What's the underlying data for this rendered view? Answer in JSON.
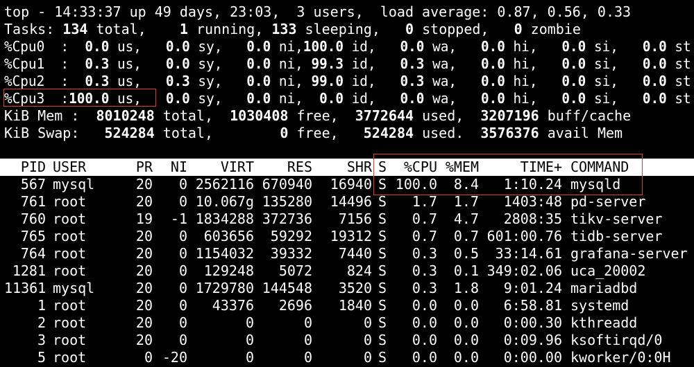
{
  "summary": {
    "top_line": "top - 14:33:37 up 49 days, 23:03,  3 users,  load average: 0.87, 0.56, 0.33",
    "tasks": {
      "label": "Tasks:",
      "total": "134",
      "total_lbl": " total,",
      "running": "1",
      "running_lbl": " running,",
      "sleeping": "133",
      "sleeping_lbl": " sleeping,",
      "stopped": "0",
      "stopped_lbl": " stopped,",
      "zombie": "0",
      "zombie_lbl": " zombie"
    },
    "cpus": [
      {
        "label": "%Cpu0  :",
        "us": "  0.0",
        "sy": "  0.0",
        "ni": "  0.0",
        "id": "100.0",
        "wa": "  0.0",
        "hi": "  0.0",
        "si": "  0.0",
        "st": "  0.0"
      },
      {
        "label": "%Cpu1  :",
        "us": "  0.3",
        "sy": "  0.0",
        "ni": "  0.0",
        "id": " 99.3",
        "wa": "  0.3",
        "hi": "  0.0",
        "si": "  0.0",
        "st": "  0.0"
      },
      {
        "label": "%Cpu2  :",
        "us": "  0.3",
        "sy": "  0.3",
        "ni": "  0.0",
        "id": " 99.0",
        "wa": "  0.3",
        "hi": "  0.0",
        "si": "  0.0",
        "st": "  0.0"
      },
      {
        "label": "%Cpu3  :",
        "us": "100.0",
        "sy": "  0.0",
        "ni": "  0.0",
        "id": "  0.0",
        "wa": "  0.0",
        "hi": "  0.0",
        "si": "  0.0",
        "st": "  0.0"
      }
    ],
    "mem": {
      "label": "KiB Mem : ",
      "total": " 8010248",
      "total_lbl": " total, ",
      "free": " 1030408",
      "free_lbl": " free, ",
      "used": " 3772644",
      "used_lbl": " used, ",
      "cache": " 3207196",
      "cache_lbl": " buff/cache"
    },
    "swap": {
      "label": "KiB Swap: ",
      "total": "  524284",
      "total_lbl": " total, ",
      "free": "       0",
      "free_lbl": " free, ",
      "used": "  524284",
      "used_lbl": " used. ",
      "avail": " 3576376",
      "avail_lbl": " avail Mem"
    }
  },
  "columns": [
    "PID",
    "USER",
    "PR",
    "NI",
    "VIRT",
    "RES",
    "SHR",
    "S",
    "%CPU",
    "%MEM",
    "TIME+",
    "COMMAND"
  ],
  "processes": [
    {
      "pid": "567",
      "user": "mysql",
      "pr": "20",
      "ni": "0",
      "virt": "2562116",
      "res": "670940",
      "shr": "16940",
      "s": "S",
      "cpu": "100.0",
      "mem": "8.4",
      "time": "1:10.24",
      "cmd": "mysqld"
    },
    {
      "pid": "761",
      "user": "root",
      "pr": "20",
      "ni": "0",
      "virt": "10.067g",
      "res": "135280",
      "shr": "14496",
      "s": "S",
      "cpu": "1.7",
      "mem": "1.7",
      "time": "1403:48",
      "cmd": "pd-server"
    },
    {
      "pid": "760",
      "user": "root",
      "pr": "19",
      "ni": "-1",
      "virt": "1834288",
      "res": "372736",
      "shr": "7156",
      "s": "S",
      "cpu": "0.7",
      "mem": "4.7",
      "time": "2808:35",
      "cmd": "tikv-server"
    },
    {
      "pid": "765",
      "user": "root",
      "pr": "20",
      "ni": "0",
      "virt": "603656",
      "res": "59292",
      "shr": "19312",
      "s": "S",
      "cpu": "0.7",
      "mem": "0.7",
      "time": "601:00.76",
      "cmd": "tidb-server"
    },
    {
      "pid": "764",
      "user": "root",
      "pr": "20",
      "ni": "0",
      "virt": "1154032",
      "res": "39332",
      "shr": "7440",
      "s": "S",
      "cpu": "0.3",
      "mem": "0.5",
      "time": "33:14.61",
      "cmd": "grafana-server"
    },
    {
      "pid": "1281",
      "user": "root",
      "pr": "20",
      "ni": "0",
      "virt": "129248",
      "res": "5072",
      "shr": "824",
      "s": "S",
      "cpu": "0.3",
      "mem": "0.1",
      "time": "349:02.06",
      "cmd": "uca_20002"
    },
    {
      "pid": "11361",
      "user": "mysql",
      "pr": "20",
      "ni": "0",
      "virt": "1729780",
      "res": "144548",
      "shr": "3520",
      "s": "S",
      "cpu": "0.3",
      "mem": "1.8",
      "time": "9:01.24",
      "cmd": "mariadbd"
    },
    {
      "pid": "1",
      "user": "root",
      "pr": "20",
      "ni": "0",
      "virt": "43376",
      "res": "2696",
      "shr": "1840",
      "s": "S",
      "cpu": "0.0",
      "mem": "0.0",
      "time": "6:58.81",
      "cmd": "systemd"
    },
    {
      "pid": "2",
      "user": "root",
      "pr": "20",
      "ni": "0",
      "virt": "0",
      "res": "0",
      "shr": "0",
      "s": "S",
      "cpu": "0.0",
      "mem": "0.0",
      "time": "0:00.30",
      "cmd": "kthreadd"
    },
    {
      "pid": "3",
      "user": "root",
      "pr": "20",
      "ni": "0",
      "virt": "0",
      "res": "0",
      "shr": "0",
      "s": "S",
      "cpu": "0.0",
      "mem": "0.0",
      "time": "0:09.96",
      "cmd": "ksoftirqd/0"
    },
    {
      "pid": "5",
      "user": "root",
      "pr": "0",
      "ni": "-20",
      "virt": "0",
      "res": "0",
      "shr": "0",
      "s": "S",
      "cpu": "0.0",
      "mem": "0.0",
      "time": "0:00.00",
      "cmd": "kworker/0:0H"
    }
  ],
  "colors": {
    "background": "#000000",
    "text": "#ffffff",
    "header_bg": "#ffffff",
    "header_text": "#000000",
    "highlight": "#e0393e"
  }
}
